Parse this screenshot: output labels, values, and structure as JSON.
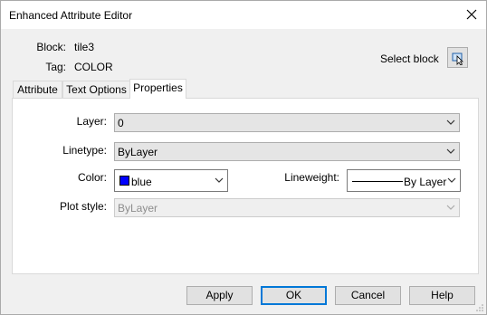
{
  "window": {
    "title": "Enhanced Attribute Editor"
  },
  "info": {
    "block_label": "Block:",
    "block_value": "tile3",
    "tag_label": "Tag:",
    "tag_value": "COLOR",
    "select_block_label": "Select block"
  },
  "tabs": [
    {
      "label": "Attribute",
      "active": false
    },
    {
      "label": "Text Options",
      "active": false
    },
    {
      "label": "Properties",
      "active": true
    }
  ],
  "properties": {
    "layer_label": "Layer:",
    "layer_value": "0",
    "linetype_label": "Linetype:",
    "linetype_value": "ByLayer",
    "color_label": "Color:",
    "color_value": "blue",
    "color_swatch": "#0000ff",
    "lineweight_label": "Lineweight:",
    "lineweight_value": "By Layer",
    "plotstyle_label": "Plot style:",
    "plotstyle_value": "ByLayer"
  },
  "buttons": {
    "apply": "Apply",
    "ok": "OK",
    "cancel": "Cancel",
    "help": "Help"
  },
  "icons": [
    "close-icon",
    "select-block-icon",
    "chevron-down-icon"
  ]
}
